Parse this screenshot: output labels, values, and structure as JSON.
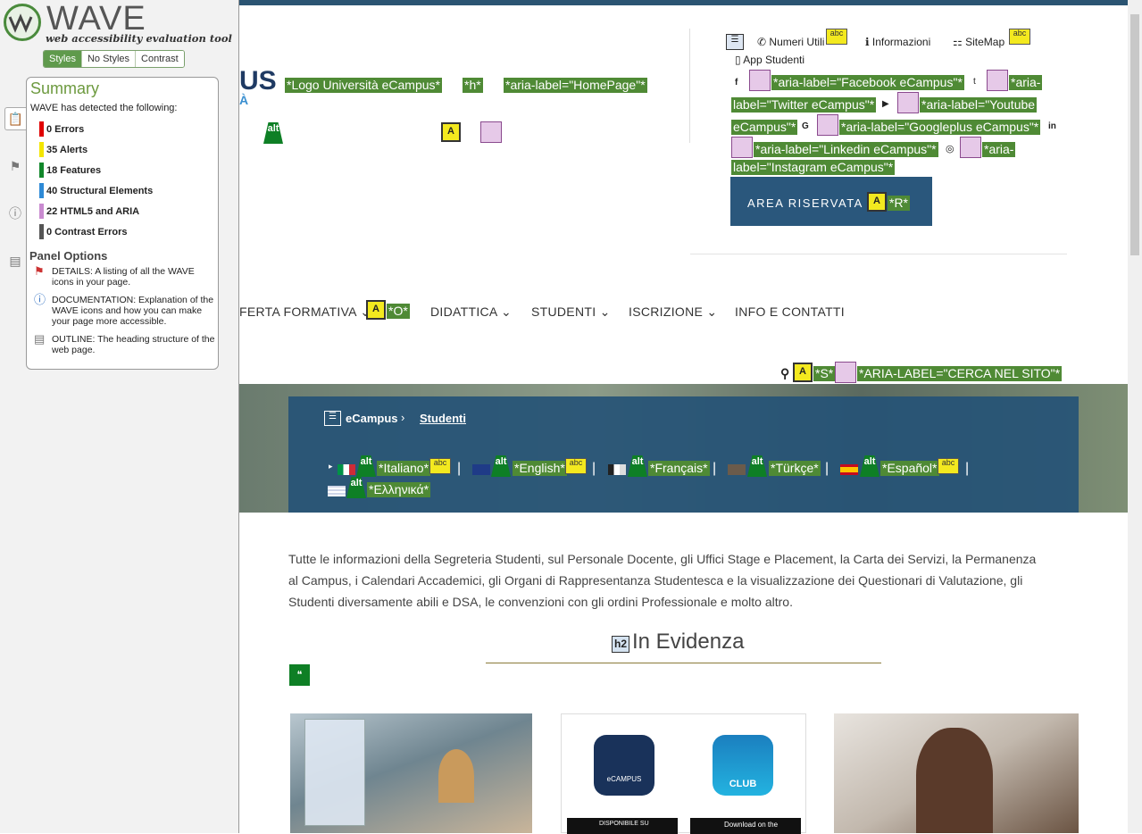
{
  "wave": {
    "title": "WAVE",
    "subtitle": "web accessibility evaluation tool",
    "tabs": [
      "Styles",
      "No Styles",
      "Contrast"
    ],
    "summary_heading": "Summary",
    "detected_text": "WAVE has detected the following:",
    "stats": [
      {
        "label": "0 Errors",
        "color": "#e00000"
      },
      {
        "label": "35 Alerts",
        "color": "#f3e600"
      },
      {
        "label": "18 Features",
        "color": "#11872b"
      },
      {
        "label": "40 Structural Elements",
        "color": "#2e8ad6"
      },
      {
        "label": "22 HTML5 and ARIA",
        "color": "#c98bd0"
      },
      {
        "label": "0 Contrast Errors",
        "color": "#555555"
      }
    ],
    "panel_options_heading": "Panel Options",
    "options": [
      {
        "icon": "flag-icon",
        "text": "DETAILS: A listing of all the WAVE icons in your page."
      },
      {
        "icon": "info-icon",
        "text": "DOCUMENTATION: Explanation of the WAVE icons and how you can make your page more accessible."
      },
      {
        "icon": "document-icon",
        "text": "OUTLINE: The heading structure of the web page."
      }
    ]
  },
  "site": {
    "logo_fragment": "US",
    "logo_fragment_sub": "À",
    "logo_labels": [
      "*Logo Università eCampus*",
      "*h*",
      "*aria-label=\"HomePage\"*"
    ],
    "top_links": [
      "Numeri Utili",
      "Informazioni",
      "SiteMap",
      "App Studenti"
    ],
    "social_labels": [
      "*aria-label=\"Facebook eCampus\"*",
      "*aria-",
      "label=\"Twitter eCampus\"*",
      "*aria-label=\"Youtube",
      "eCampus\"*",
      "*aria-label=\"Googleplus eCampus\"*",
      "*aria-label=\"Linkedin eCampus\"*",
      "*aria-",
      "label=\"Instagram eCampus\"*"
    ],
    "area_riservata": "AREA RISERVATA",
    "area_key": "*R*",
    "nav": [
      "FERTA FORMATIVA",
      "DIDATTICA",
      "STUDENTI",
      "ISCRIZIONE",
      "INFO E CONTATTI"
    ],
    "nav_key": "*O*",
    "search_key": "*S*",
    "search_label": "*ARIA-LABEL=\"CERCA NEL SITO\"*",
    "breadcrumb": [
      "eCampus",
      "Studenti"
    ],
    "languages": [
      "*Italiano*",
      "*English*",
      "*Français*",
      "*Türkçe*",
      "*Español*",
      "*Ελληνικά*"
    ],
    "intro": "Tutte le informazioni della Segreteria Studenti, sul Personale Docente, gli Uffici Stage e Placement, la Carta dei Servizi, la Permanenza al Campus, i Calendari Accademici, gli Organi di Rappresentanza Studentesca e la visualizzazione dei Questionari di Valutazione, gli Studenti diversamente abili e DSA, le convenzioni con gli ordini Professionale e molto altro.",
    "h2_tag": "h2",
    "h2": "In Evidenza",
    "app_tiles": [
      "CLUB",
      "DISPONIBILE SU",
      "Download on the"
    ],
    "ecampus_tile": "eCAMPUS"
  },
  "icons": {
    "alt": "alt",
    "access_key": "A",
    "abc": "abc"
  }
}
